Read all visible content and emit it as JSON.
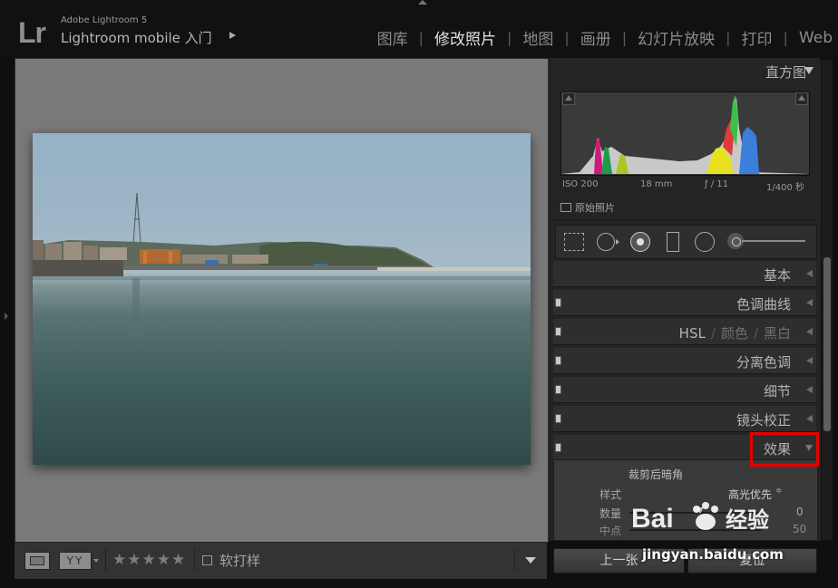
{
  "app": {
    "logo": "Lr",
    "version": "Adobe Lightroom 5",
    "subtitle": "Lightroom mobile 入门"
  },
  "modules": [
    {
      "label": "图库",
      "active": false
    },
    {
      "label": "修改照片",
      "active": true
    },
    {
      "label": "地图",
      "active": false
    },
    {
      "label": "画册",
      "active": false
    },
    {
      "label": "幻灯片放映",
      "active": false
    },
    {
      "label": "打印",
      "active": false
    },
    {
      "label": "Web",
      "active": false
    }
  ],
  "histogram": {
    "title": "直方图",
    "iso": "ISO 200",
    "focal": "18 mm",
    "aperture": "ƒ / 11",
    "shutter": "1/400 秒",
    "original_label": "原始照片"
  },
  "panels": {
    "basic": "基本",
    "tone_curve": "色调曲线",
    "hsl": "HSL",
    "hsl_color": "颜色",
    "hsl_bw": "黑白",
    "split_toning": "分离色调",
    "detail": "细节",
    "lens_corrections": "镜头校正",
    "effects": "效果"
  },
  "effects": {
    "vignette_title": "裁剪后暗角",
    "style_label": "样式",
    "style_value": "高光优先",
    "style_arrows": "≑",
    "amount_label": "数量",
    "amount_value": "0",
    "midpoint_label": "中点",
    "midpoint_value": "50"
  },
  "toolbar": {
    "compare": "YY",
    "stars": "★★★★★",
    "soft_proof": "软打样"
  },
  "buttons": {
    "previous": "上一张",
    "reset": "复位"
  },
  "watermark": {
    "text": "jingyan.baidu.com",
    "logo_text": "Bai",
    "logo_text2": "经验"
  },
  "colors": {
    "accent_highlight": "#e60000",
    "panel_bg": "#242424",
    "center_bg": "#7a7a7a"
  }
}
